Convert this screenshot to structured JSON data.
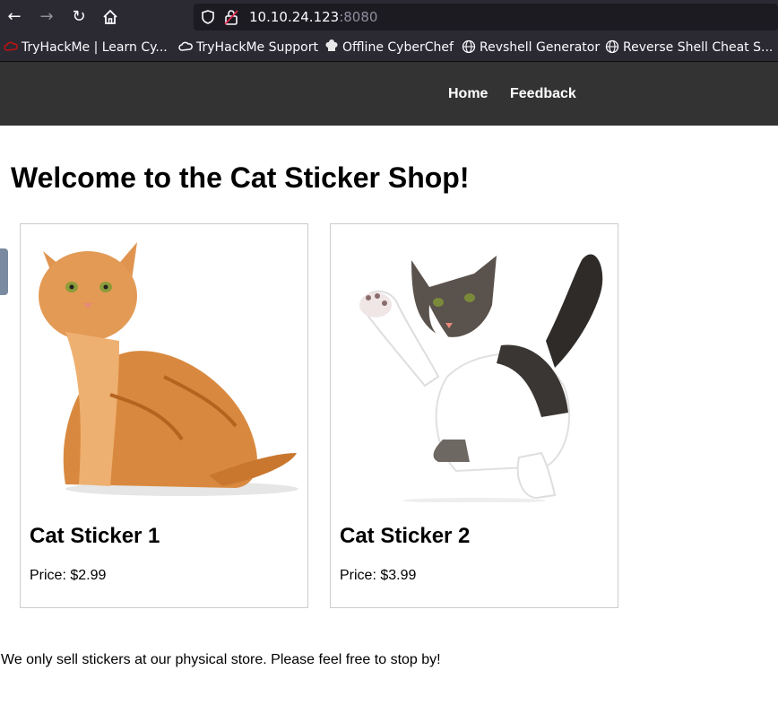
{
  "browser": {
    "url_host": "10.10.24.123",
    "url_port": ":8080",
    "bookmarks": [
      {
        "label": "TryHackMe | Learn Cy..."
      },
      {
        "label": "TryHackMe Support"
      },
      {
        "label": "Offline CyberChef"
      },
      {
        "label": "Revshell Generator"
      },
      {
        "label": "Reverse Shell Cheat S..."
      }
    ]
  },
  "nav": {
    "home": "Home",
    "feedback": "Feedback"
  },
  "page": {
    "title": "Welcome to the Cat Sticker Shop!",
    "products": [
      {
        "name": "Cat Sticker 1",
        "price": "Price: $2.99"
      },
      {
        "name": "Cat Sticker 2",
        "price": "Price: $3.99"
      }
    ],
    "footer": "We only sell stickers at our physical store. Please feel free to stop by!"
  },
  "colors": {
    "browser_chrome": "#2b2a33",
    "site_nav": "#333333",
    "card_border": "#cccccc"
  }
}
